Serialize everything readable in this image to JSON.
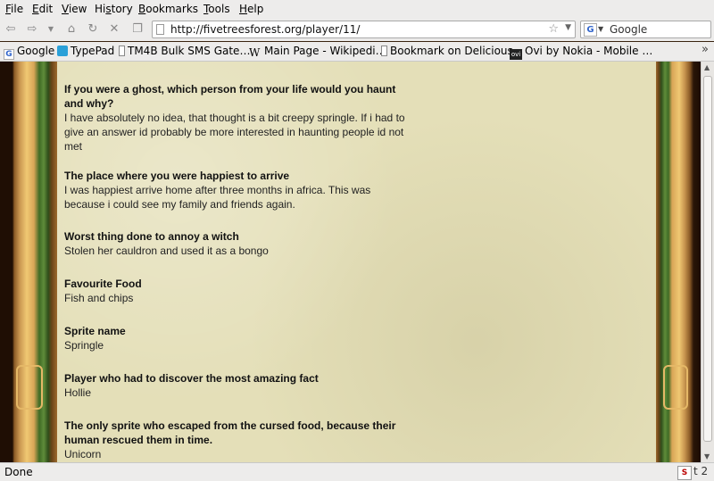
{
  "menu": [
    "File",
    "Edit",
    "View",
    "History",
    "Bookmarks",
    "Tools",
    "Help"
  ],
  "menu_access": [
    "F",
    "E",
    "V",
    "s",
    "B",
    "T",
    "H"
  ],
  "address": {
    "url": "http://fivetreesforest.org/player/11/"
  },
  "search": {
    "engine": "Google"
  },
  "bookmarks": [
    {
      "label": "Google",
      "icon": "google-icon"
    },
    {
      "label": "TypePad",
      "icon": "typepad-icon"
    },
    {
      "label": "TM4B Bulk SMS Gate…",
      "icon": "bookmark-icon"
    },
    {
      "label": "Main Page - Wikipedi…",
      "icon": "wikipedia-icon"
    },
    {
      "label": "Bookmark on Delicious",
      "icon": "bookmark-icon"
    },
    {
      "label": "Ovi by Nokia - Mobile …",
      "icon": "ovi-icon"
    }
  ],
  "qa": [
    {
      "q": "If you were a ghost, which person from your life would you haunt and why?",
      "a": "I have absolutely no idea, that thought is a bit creepy springle. If i had to give an answer id probably be more interested in haunting people id not met"
    },
    {
      "q": "The place where you were happiest to arrive",
      "a": "I was happiest arrive home after three months in africa. This was because i could see my family and friends again."
    },
    {
      "q": "Worst thing done to annoy a witch",
      "a": "Stolen her cauldron and used it as a bongo"
    },
    {
      "q": "Favourite Food",
      "a": "Fish and chips"
    },
    {
      "q": "Sprite name",
      "a": "Springle"
    },
    {
      "q": "Player who had to discover the most amazing fact",
      "a": "Hollie"
    },
    {
      "q": "The only sprite who escaped from the cursed food, because their human rescued them in time.",
      "a": "Unicorn"
    }
  ],
  "status": {
    "text": "Done",
    "addon_count": "2"
  }
}
